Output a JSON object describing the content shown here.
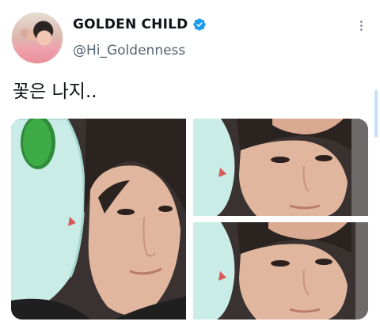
{
  "tweet": {
    "author_name": "GOLDEN CHILD",
    "handle": "@Hi_Goldenness",
    "text": "꽃은 나지..",
    "verified": true,
    "verified_color": "#1d9bf0"
  },
  "icons": {
    "verified": "verified-badge-icon",
    "more": "more-options-icon"
  },
  "media": {
    "photo_count": 3
  }
}
